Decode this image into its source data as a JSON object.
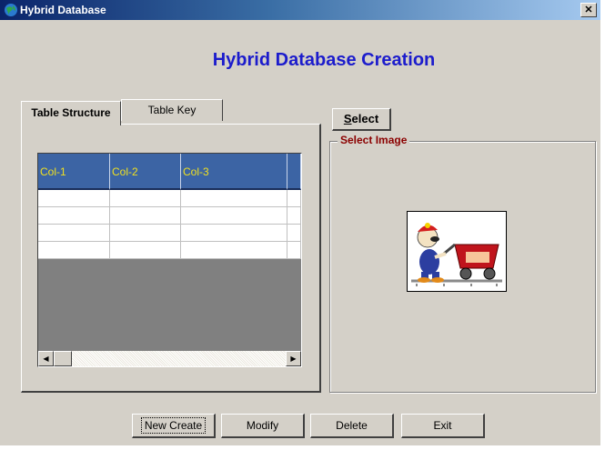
{
  "window": {
    "title": "Hybrid Database",
    "close_glyph": "✕"
  },
  "heading": "Hybrid Database Creation",
  "tabs": [
    {
      "label": "Table Structure",
      "active": true
    },
    {
      "label": "Table Key",
      "active": false
    }
  ],
  "grid": {
    "columns": [
      "Col-1",
      "Col-2",
      "Col-3",
      ""
    ],
    "rows": [
      [
        "",
        "",
        "",
        ""
      ],
      [
        "",
        "",
        "",
        ""
      ],
      [
        "",
        "",
        "",
        ""
      ],
      [
        "",
        "",
        "",
        ""
      ]
    ],
    "header_color": "#3c64a4",
    "header_text_color": "#f0e020"
  },
  "select_button": {
    "accel": "S",
    "rest": "elect"
  },
  "image_group": {
    "legend": "Select Image",
    "legend_color": "#8b0000",
    "image": "miner-with-cart-icon"
  },
  "buttons": {
    "new_create": "New Create",
    "modify": "Modify",
    "delete": "Delete",
    "exit": "Exit"
  }
}
